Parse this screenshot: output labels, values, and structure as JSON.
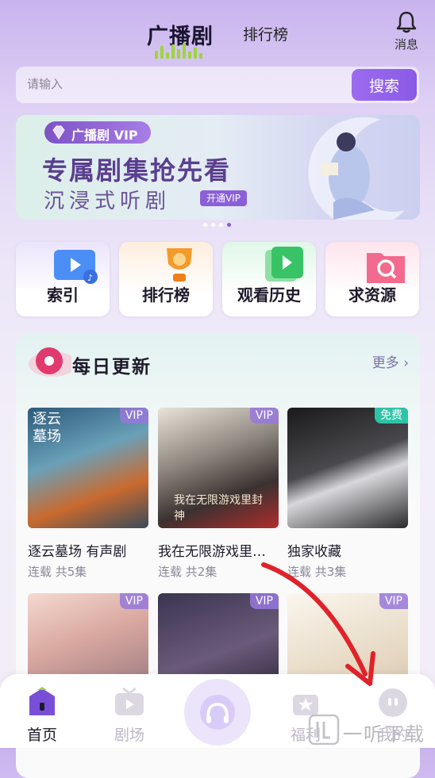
{
  "header": {
    "logo_text": "广播剧",
    "tab_rank": "排行榜",
    "bell_label": "消息"
  },
  "search": {
    "placeholder": "请输入",
    "button_label": "搜索"
  },
  "banner": {
    "badge_label": "广播剧 VIP",
    "title": "专属剧集抢先看",
    "subtitle": "沉浸式听剧",
    "vip_button": "开通VIP",
    "page_count": 4,
    "active_page": 4
  },
  "quick_tiles": [
    {
      "label": "索引",
      "icon": "video-folder-icon"
    },
    {
      "label": "排行榜",
      "icon": "trophy-icon"
    },
    {
      "label": "观看历史",
      "icon": "play-stack-icon"
    },
    {
      "label": "求资源",
      "icon": "search-folder-icon"
    }
  ],
  "daily": {
    "title": "每日更新",
    "more_label": "更多",
    "items": [
      {
        "title": "逐云墓场 有声剧",
        "meta": "连载 共5集",
        "badge": "VIP",
        "cover_text": "逐云墓场"
      },
      {
        "title": "我在无限游戏里…",
        "meta": "连载 共2集",
        "badge": "VIP",
        "cover_text": "我在无限游戏里封神"
      },
      {
        "title": "独家收藏",
        "meta": "连载 共3集",
        "badge": "免费",
        "cover_text": ""
      },
      {
        "title": "",
        "meta": "",
        "badge": "VIP",
        "cover_text": ""
      },
      {
        "title": "",
        "meta": "",
        "badge": "VIP",
        "cover_text": ""
      },
      {
        "title": "",
        "meta": "",
        "badge": "VIP",
        "cover_text": ""
      }
    ]
  },
  "tabbar": {
    "home": "首页",
    "theater": "剧场",
    "welfare": "福利",
    "mine": "我的"
  },
  "watermark": {
    "text": "一听下载"
  },
  "colors": {
    "accent": "#8a5ae6",
    "free_badge": "#2ec4a6",
    "annotation_arrow": "#e0222a"
  }
}
